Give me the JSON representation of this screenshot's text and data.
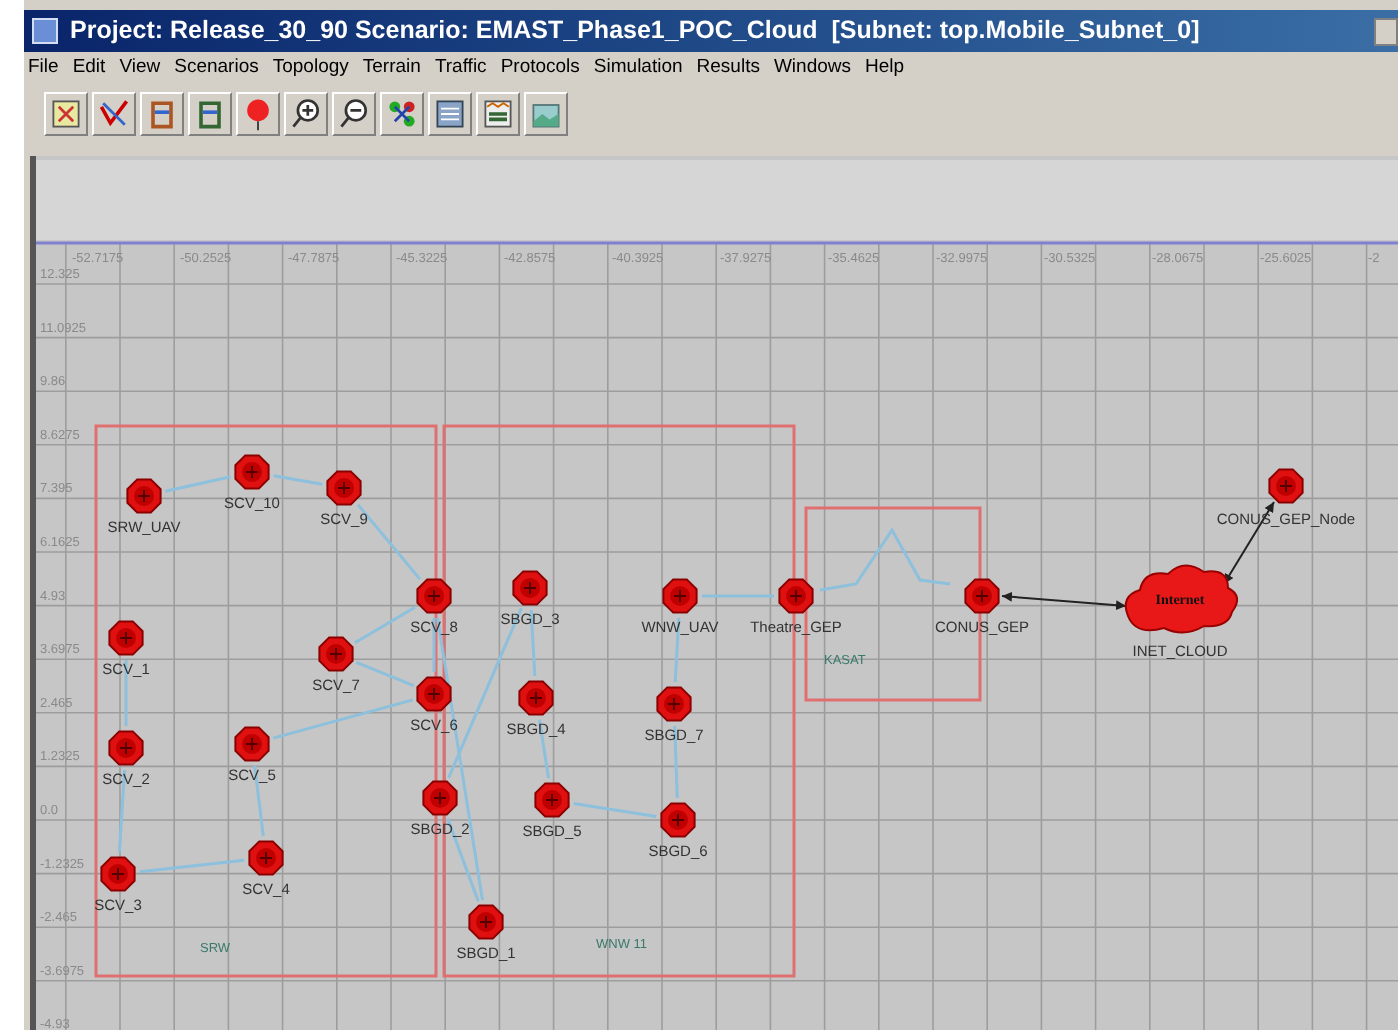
{
  "window": {
    "title": "Project: Release_30_90 Scenario: EMAST_Phase1_POC_Cloud  [Subnet: top.Mobile_Subnet_0]"
  },
  "menu": [
    "File",
    "Edit",
    "View",
    "Scenarios",
    "Topology",
    "Terrain",
    "Traffic",
    "Protocols",
    "Simulation",
    "Results",
    "Windows",
    "Help"
  ],
  "x_axis": [
    "-52.7175",
    "-50.2525",
    "-47.7875",
    "-45.3225",
    "-42.8575",
    "-40.3925",
    "-37.9275",
    "-35.4625",
    "-32.9975",
    "-30.5325",
    "-28.0675",
    "-25.6025",
    "-2"
  ],
  "y_axis": [
    "12.325",
    "11.0925",
    "9.86",
    "8.6275",
    "7.395",
    "6.1625",
    "4.93",
    "3.6975",
    "2.465",
    "1.2325",
    "0.0",
    "-1.2325",
    "-2.465",
    "-3.6975",
    "-4.93"
  ],
  "subnets": [
    {
      "label": "SRW"
    },
    {
      "label": "WNW 11"
    },
    {
      "label": "KASAT"
    }
  ],
  "nodes": [
    {
      "name": "SRW_UAV",
      "kind": "router"
    },
    {
      "name": "SCV_10",
      "kind": "router"
    },
    {
      "name": "SCV_9",
      "kind": "router"
    },
    {
      "name": "SCV_8",
      "kind": "router"
    },
    {
      "name": "SBGD_3",
      "kind": "router"
    },
    {
      "name": "WNW_UAV",
      "kind": "router"
    },
    {
      "name": "Theatre_GEP",
      "kind": "router"
    },
    {
      "name": "CONUS_GEP",
      "kind": "router"
    },
    {
      "name": "INET_CLOUD",
      "kind": "cloud",
      "cloud_text": "Internet"
    },
    {
      "name": "CONUS_GEP_Node",
      "kind": "router"
    },
    {
      "name": "SCV_1",
      "kind": "router"
    },
    {
      "name": "SCV_7",
      "kind": "router"
    },
    {
      "name": "SCV_6",
      "kind": "router"
    },
    {
      "name": "SBGD_4",
      "kind": "router"
    },
    {
      "name": "SBGD_7",
      "kind": "router"
    },
    {
      "name": "SCV_2",
      "kind": "router"
    },
    {
      "name": "SCV_5",
      "kind": "router"
    },
    {
      "name": "SBGD_2",
      "kind": "router"
    },
    {
      "name": "SBGD_5",
      "kind": "router"
    },
    {
      "name": "SBGD_6",
      "kind": "router"
    },
    {
      "name": "SCV_3",
      "kind": "router"
    },
    {
      "name": "SCV_4",
      "kind": "router"
    },
    {
      "name": "SBGD_1",
      "kind": "router"
    }
  ]
}
